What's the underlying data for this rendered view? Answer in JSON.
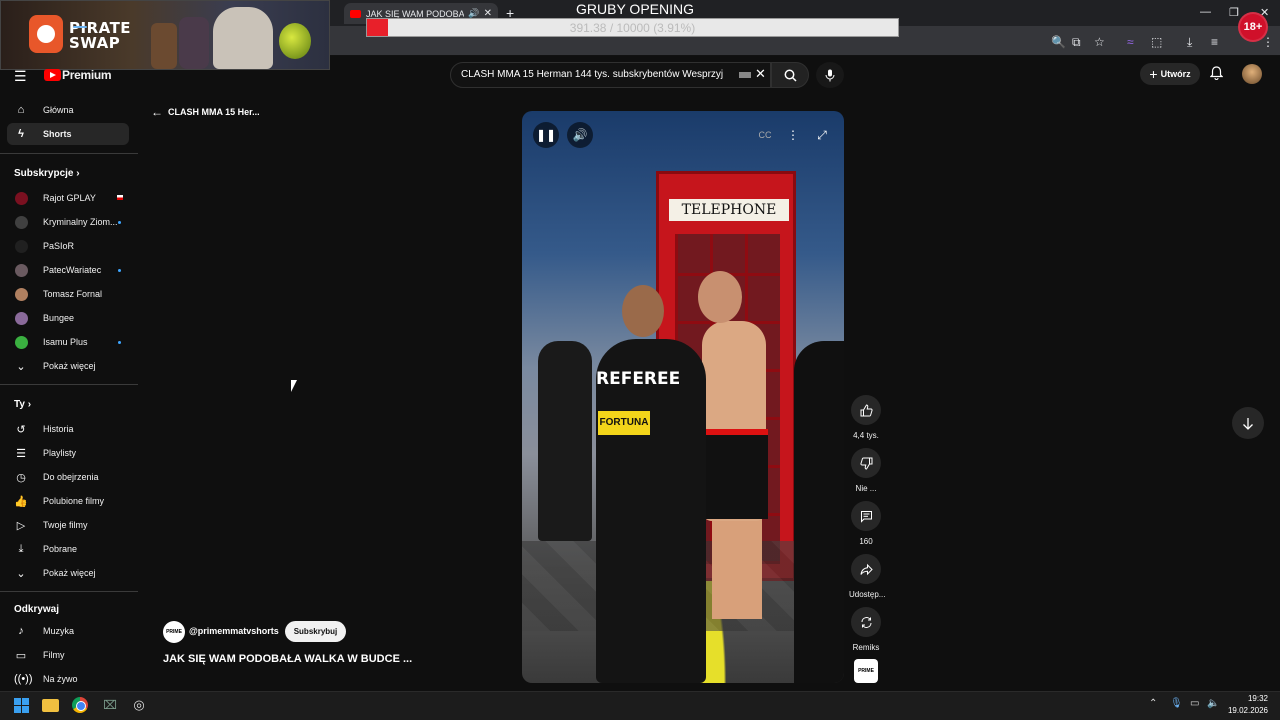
{
  "browser": {
    "tab_title": "JAK SIĘ WAM PODOBAŁA W",
    "new_tab": "+",
    "back_arrow": "‹"
  },
  "stream_overlay": {
    "logo_line1": "PIRATE",
    "logo_line2": "SWAP",
    "goal_title": "GRUBY OPENING",
    "goal_text": "391.38 / 10000 (3.91%)",
    "goal_fraction": 0.0391,
    "age_badge": "18+",
    "goal_color": "#e8202a"
  },
  "header": {
    "brand": "Premium",
    "search_query": "CLASH MMA 15  Herman 144 tys. subskrybentów  Wesprzyj",
    "create_label": "Utwórz"
  },
  "sidebar": {
    "main": [
      {
        "label": "Główna",
        "icon": "home-icon"
      },
      {
        "label": "Shorts",
        "icon": "shorts-icon",
        "active": true
      }
    ],
    "subscriptions_header": "Subskrypcje",
    "subscriptions": [
      {
        "label": "Rajot GPLAY",
        "color": "#7a1020"
      },
      {
        "label": "Kryminalny Ziom...",
        "color": "#404040"
      },
      {
        "label": "PaSIoR",
        "color": "#202020"
      },
      {
        "label": "PatecWariatec",
        "color": "#6a5a60"
      },
      {
        "label": "Tomasz Fornal",
        "color": "#b08060"
      },
      {
        "label": "Bungee",
        "color": "#8a6a9a"
      },
      {
        "label": "Isamu Plus",
        "color": "#3ab040"
      }
    ],
    "show_more": "Pokaż więcej",
    "you_header": "Ty",
    "you": [
      {
        "label": "Historia",
        "icon": "history-icon"
      },
      {
        "label": "Playlisty",
        "icon": "playlist-icon"
      },
      {
        "label": "Do obejrzenia",
        "icon": "watch-later-icon"
      },
      {
        "label": "Polubione filmy",
        "icon": "liked-icon"
      },
      {
        "label": "Twoje filmy",
        "icon": "your-videos-icon"
      },
      {
        "label": "Pobrane",
        "icon": "download-icon"
      }
    ],
    "show_more_2": "Pokaż więcej",
    "explore_header": "Odkrywaj",
    "explore": [
      {
        "label": "Muzyka",
        "icon": "music-icon"
      },
      {
        "label": "Filmy",
        "icon": "movies-icon"
      },
      {
        "label": "Na żywo",
        "icon": "live-icon"
      }
    ]
  },
  "shorts": {
    "back_label": "CLASH MMA 15 Her...",
    "channel": "@primemmatvshorts",
    "subscribe": "Subskrybuj",
    "title": "JAK SIĘ WAM PODOBAŁA WALKA W BUDCE ...",
    "video_sign": "TELEPHONE",
    "video_ref_text": "REFEREE",
    "video_badge_text": "FORTUNA",
    "channel_mark": "PRIME",
    "actions": {
      "like": "4,4 tys.",
      "dislike": "Nie ...",
      "comments": "160",
      "share": "Udostęp...",
      "remix": "Remiks"
    }
  },
  "taskbar": {
    "time": "19:32",
    "date": "19.02.2026"
  }
}
